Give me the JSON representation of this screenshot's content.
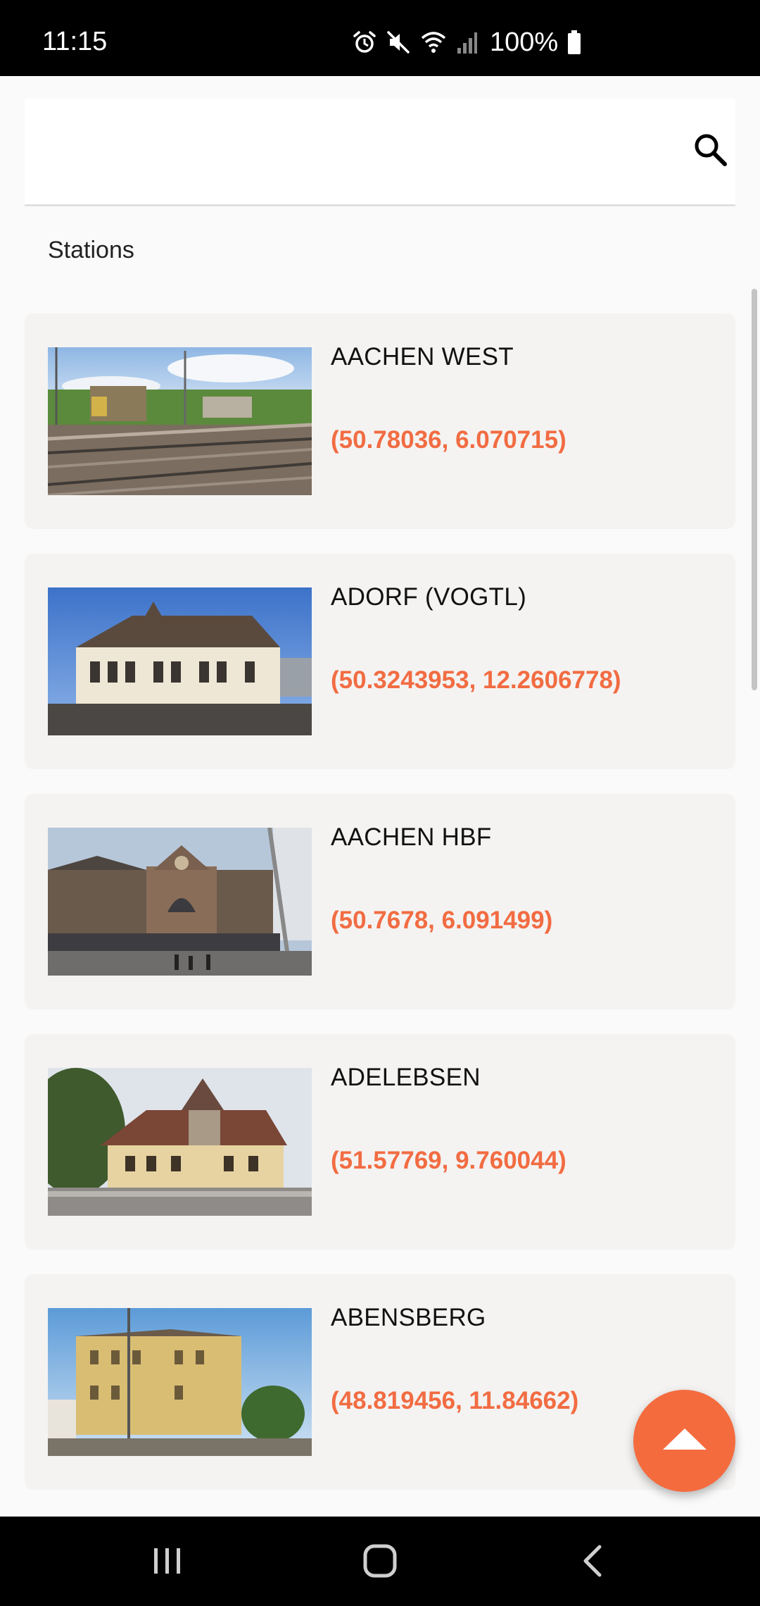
{
  "status_bar": {
    "time": "11:15",
    "battery": "100%",
    "icons": [
      "alarm-icon",
      "mute-icon",
      "wifi-icon",
      "signal-icon",
      "battery-icon"
    ]
  },
  "search": {
    "value": "",
    "placeholder": "",
    "icon": "search-icon"
  },
  "section": {
    "title": "Stations"
  },
  "stations": [
    {
      "name": "AACHEN WEST",
      "coords": "(50.78036, 6.070715)"
    },
    {
      "name": "ADORF (VOGTL)",
      "coords": "(50.3243953, 12.2606778)"
    },
    {
      "name": "AACHEN HBF",
      "coords": "(50.7678, 6.091499)"
    },
    {
      "name": "ADELEBSEN",
      "coords": "(51.57769, 9.760044)"
    },
    {
      "name": "ABENSBERG",
      "coords": "(48.819456, 11.84662)"
    }
  ],
  "colors": {
    "accent": "#f26c42",
    "card_bg": "#f4f3f2",
    "fab": "#f46b3e"
  },
  "nav": {
    "buttons": [
      "recent-apps",
      "home",
      "back"
    ]
  }
}
